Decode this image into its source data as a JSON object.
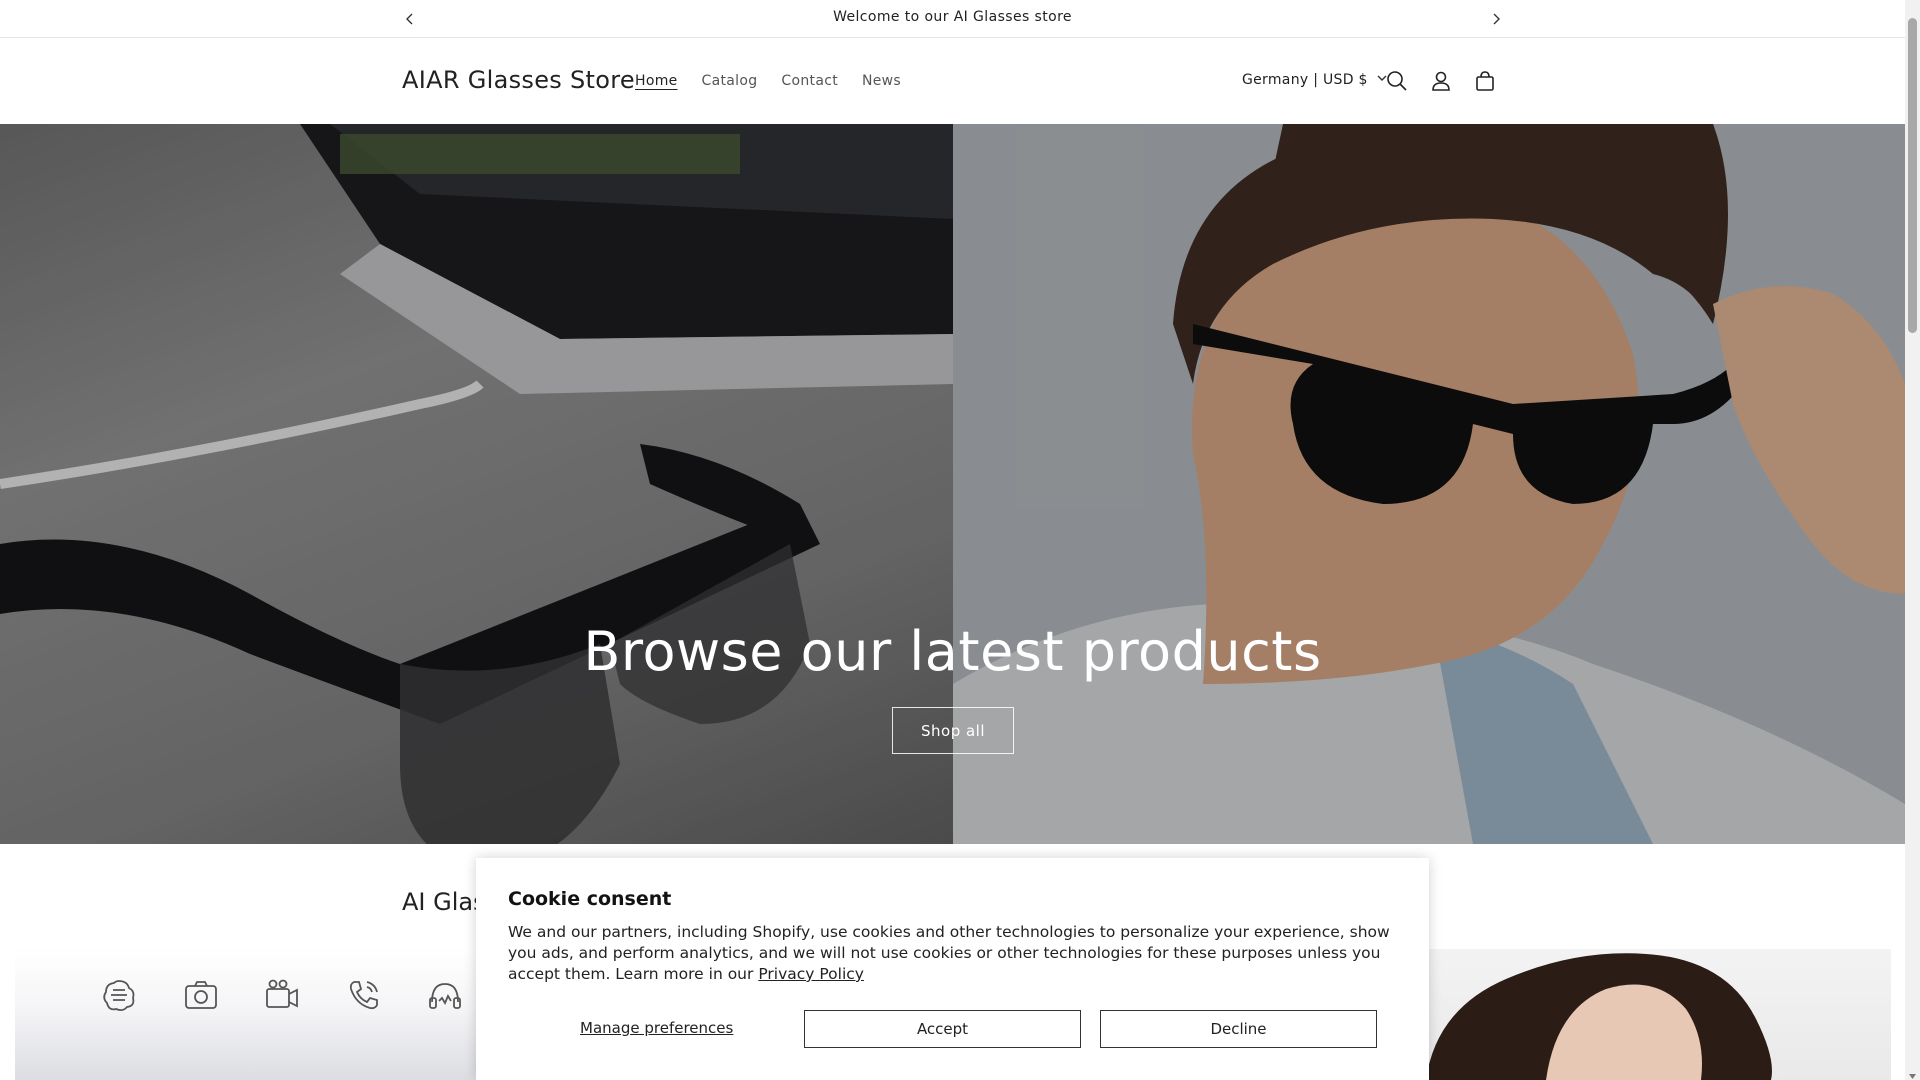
{
  "announcement": {
    "message": "Welcome to our AI Glasses store",
    "prev_icon": "chevron-left-icon",
    "next_icon": "chevron-right-icon"
  },
  "header": {
    "logo": "AIAR Glasses Store",
    "nav": [
      {
        "label": "Home",
        "active": true
      },
      {
        "label": "Catalog",
        "active": false
      },
      {
        "label": "Contact",
        "active": false
      },
      {
        "label": "News",
        "active": false
      }
    ],
    "locale": "Germany | USD $",
    "icons": [
      "search-icon",
      "account-icon",
      "cart-icon"
    ]
  },
  "hero": {
    "title": "Browse our latest products",
    "button": "Shop all"
  },
  "section": {
    "title_visible": "AI Glas",
    "feature_icons": [
      "ai-chip-icon",
      "camera-icon",
      "video-icon",
      "phone-call-icon",
      "headphones-icon"
    ]
  },
  "cookie": {
    "title": "Cookie consent",
    "body": "We and our partners, including Shopify, use cookies and other technologies to personalize your experience, show you ads, and perform analytics, and we will not use cookies or other technologies for these purposes unless you accept them. Learn more in our ",
    "link": "Privacy Policy",
    "manage": "Manage preferences",
    "accept": "Accept",
    "decline": "Decline"
  },
  "colors": {
    "text": "#121212",
    "border": "#e6e6e6",
    "hero_text": "#ffffff"
  }
}
